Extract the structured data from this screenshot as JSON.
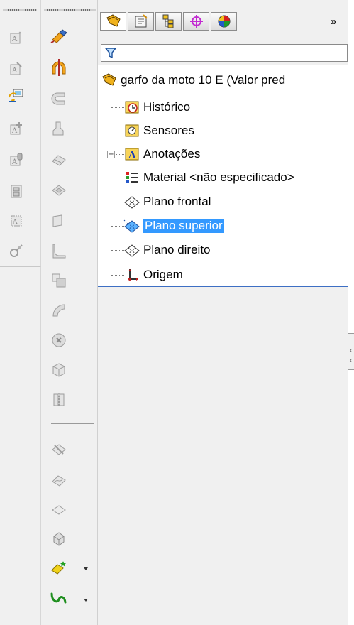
{
  "feature_tree": {
    "root_label": "garfo da moto 10 E  (Valor pred",
    "items": [
      {
        "label": "Histórico",
        "icon": "history-clock-icon"
      },
      {
        "label": "Sensores",
        "icon": "sensor-icon"
      },
      {
        "label": "Anotações",
        "icon": "annotations-A-icon",
        "expandable": true
      },
      {
        "label": "Material <não especificado>",
        "icon": "material-icon"
      },
      {
        "label": "Plano frontal",
        "icon": "plane-icon"
      },
      {
        "label": "Plano superior",
        "icon": "plane-icon-selected",
        "selected": true
      },
      {
        "label": "Plano direito",
        "icon": "plane-icon"
      },
      {
        "label": "Origem",
        "icon": "origin-icon"
      }
    ]
  },
  "panel_tabs": [
    {
      "name": "featuremanager-tab",
      "icon": "part-tree-icon"
    },
    {
      "name": "propertymanager-tab",
      "icon": "property-icon"
    },
    {
      "name": "configurationmanager-tab",
      "icon": "configuration-icon"
    },
    {
      "name": "dimxpert-tab",
      "icon": "crosshair-icon"
    },
    {
      "name": "display-manager-tab",
      "icon": "appearance-pie-icon"
    }
  ],
  "more_tabs_label": "»",
  "colors": {
    "selection": "#3399ff",
    "tree_bottom_line": "#3d6fc4",
    "accent_orange": "#e08a1e",
    "accent_green": "#2d8a2d"
  }
}
